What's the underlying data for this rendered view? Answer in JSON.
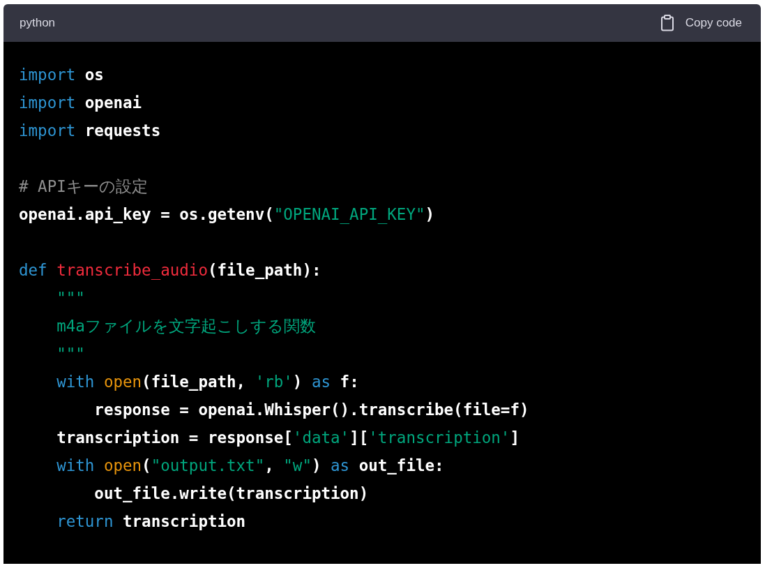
{
  "code_block": {
    "language": "python",
    "copy_button": "Copy code",
    "lines": [
      {
        "kind": "code",
        "tokens": [
          {
            "kind": "keyword",
            "text": "import"
          },
          {
            "kind": "plain",
            "text": " os"
          }
        ]
      },
      {
        "kind": "code",
        "tokens": [
          {
            "kind": "keyword",
            "text": "import"
          },
          {
            "kind": "plain",
            "text": " openai"
          }
        ]
      },
      {
        "kind": "code",
        "tokens": [
          {
            "kind": "keyword",
            "text": "import"
          },
          {
            "kind": "plain",
            "text": " requests"
          }
        ]
      },
      {
        "kind": "blank"
      },
      {
        "kind": "code",
        "tokens": [
          {
            "kind": "comment",
            "text": "# APIキーの設定"
          }
        ]
      },
      {
        "kind": "code",
        "tokens": [
          {
            "kind": "plain",
            "text": "openai.api_key = os.getenv("
          },
          {
            "kind": "string",
            "text": "\"OPENAI_API_KEY\""
          },
          {
            "kind": "plain",
            "text": ")"
          }
        ]
      },
      {
        "kind": "blank"
      },
      {
        "kind": "code",
        "tokens": [
          {
            "kind": "keyword",
            "text": "def"
          },
          {
            "kind": "function",
            "text": " transcribe_audio"
          },
          {
            "kind": "plain",
            "text": "(file_path):"
          }
        ]
      },
      {
        "kind": "code",
        "tokens": [
          {
            "kind": "string",
            "text": "    \"\"\""
          }
        ]
      },
      {
        "kind": "code",
        "tokens": [
          {
            "kind": "string",
            "text": "    m4aファイルを文字起こしする関数"
          }
        ]
      },
      {
        "kind": "code",
        "tokens": [
          {
            "kind": "string",
            "text": "    \"\"\""
          }
        ]
      },
      {
        "kind": "code",
        "tokens": [
          {
            "kind": "keyword",
            "text": "    with"
          },
          {
            "kind": "builtin",
            "text": " open"
          },
          {
            "kind": "plain",
            "text": "(file_path, "
          },
          {
            "kind": "string",
            "text": "'rb'"
          },
          {
            "kind": "plain",
            "text": ") "
          },
          {
            "kind": "keyword",
            "text": "as"
          },
          {
            "kind": "plain",
            "text": " f:"
          }
        ]
      },
      {
        "kind": "code",
        "tokens": [
          {
            "kind": "plain",
            "text": "        response = openai.Whisper().transcribe(file=f)"
          }
        ]
      },
      {
        "kind": "code",
        "tokens": [
          {
            "kind": "plain",
            "text": "    transcription = response["
          },
          {
            "kind": "string",
            "text": "'data'"
          },
          {
            "kind": "plain",
            "text": "]["
          },
          {
            "kind": "string",
            "text": "'transcription'"
          },
          {
            "kind": "plain",
            "text": "]"
          }
        ]
      },
      {
        "kind": "code",
        "tokens": [
          {
            "kind": "keyword",
            "text": "    with"
          },
          {
            "kind": "builtin",
            "text": " open"
          },
          {
            "kind": "plain",
            "text": "("
          },
          {
            "kind": "string",
            "text": "\"output.txt\""
          },
          {
            "kind": "plain",
            "text": ", "
          },
          {
            "kind": "string",
            "text": "\"w\""
          },
          {
            "kind": "plain",
            "text": ") "
          },
          {
            "kind": "keyword",
            "text": "as"
          },
          {
            "kind": "plain",
            "text": " out_file:"
          }
        ]
      },
      {
        "kind": "code",
        "tokens": [
          {
            "kind": "plain",
            "text": "        out_file.write(transcription)"
          }
        ]
      },
      {
        "kind": "code",
        "tokens": [
          {
            "kind": "keyword",
            "text": "    return"
          },
          {
            "kind": "plain",
            "text": " transcription"
          }
        ]
      }
    ]
  }
}
